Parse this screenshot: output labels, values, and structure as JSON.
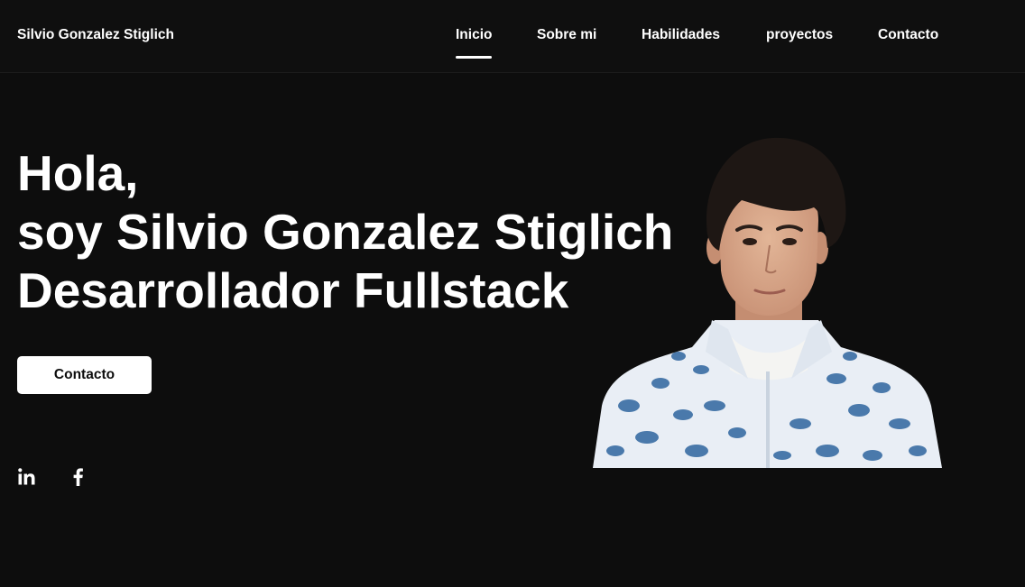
{
  "header": {
    "brand": "Silvio Gonzalez Stiglich",
    "nav": [
      {
        "label": "Inicio",
        "active": true
      },
      {
        "label": "Sobre mi",
        "active": false
      },
      {
        "label": "Habilidades",
        "active": false
      },
      {
        "label": "proyectos",
        "active": false
      },
      {
        "label": "Contacto",
        "active": false
      }
    ]
  },
  "hero": {
    "line1": "Hola,",
    "line2": "soy Silvio Gonzalez Stiglich",
    "line3": "Desarrollador Fullstack",
    "cta_label": "Contacto"
  },
  "social": [
    {
      "icon": "linkedin-icon"
    },
    {
      "icon": "facebook-icon"
    }
  ],
  "portrait": {
    "icon": "portrait-photo",
    "shirt_color": "#e9eef5",
    "print_color": "#4a79ab",
    "hair_color": "#1e1714",
    "skin_color": "#d9a98b"
  },
  "colors": {
    "background": "#0d0d0d",
    "header_bg": "#0f0f0f",
    "text": "#ffffff",
    "button_bg": "#ffffff",
    "button_text": "#0d0d0d"
  }
}
